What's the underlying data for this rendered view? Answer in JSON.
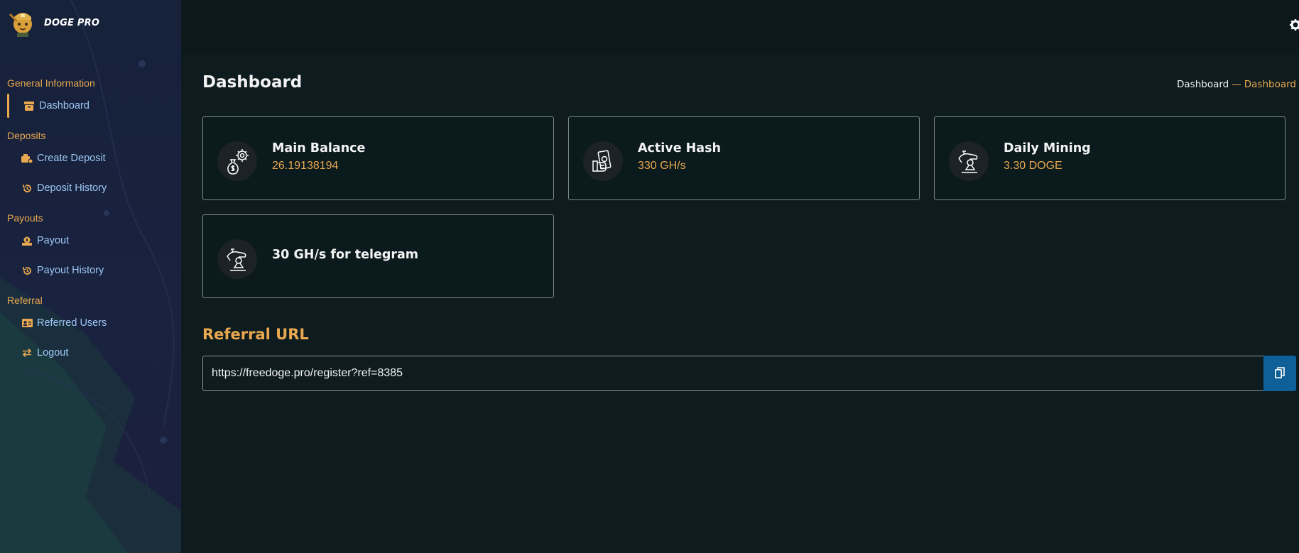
{
  "brand": {
    "name": "DOGE PRO"
  },
  "sidebar": {
    "sections": [
      {
        "title": "General Information",
        "items": [
          {
            "label": "Dashboard",
            "icon": "archive-icon"
          }
        ]
      },
      {
        "title": "Deposits",
        "items": [
          {
            "label": "Create Deposit",
            "icon": "wallet-add-icon"
          },
          {
            "label": "Deposit History",
            "icon": "history-icon"
          }
        ]
      },
      {
        "title": "Payouts",
        "items": [
          {
            "label": "Payout",
            "icon": "coin-hand-icon"
          },
          {
            "label": "Payout History",
            "icon": "history-icon"
          }
        ]
      },
      {
        "title": "Referral",
        "items": [
          {
            "label": "Referred Users",
            "icon": "id-card-icon"
          },
          {
            "label": "Logout",
            "icon": "exchange-icon"
          }
        ]
      }
    ]
  },
  "page": {
    "title": "Dashboard",
    "breadcrumb": {
      "home": "Dashboard",
      "separator": "—",
      "current": "Dashboard"
    }
  },
  "cards": [
    {
      "title": "Main Balance",
      "value": "26.19138194",
      "icon": "money-bag-gear-icon"
    },
    {
      "title": "Active Hash",
      "value": "330 GH/s",
      "icon": "cash-hand-icon"
    },
    {
      "title": "Daily Mining",
      "value": "3.30 DOGE",
      "icon": "hand-coin-icon"
    },
    {
      "title": "30 GH/s for telegram",
      "value": "",
      "icon": "hand-coin-icon"
    }
  ],
  "referral": {
    "title": "Referral URL",
    "url": "https://freedoge.pro/register?ref=8385",
    "copy_icon": "copy-icon"
  },
  "colors": {
    "accent": "#e9a84f",
    "link": "#9ec8f5",
    "copy_button": "#0f5f99",
    "background": "#0e1c1f",
    "sidebar": "#19223f"
  }
}
